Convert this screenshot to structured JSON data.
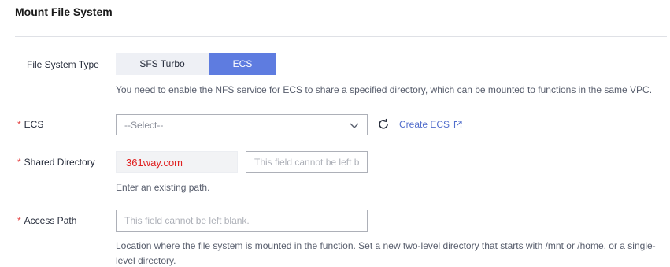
{
  "title": "Mount File System",
  "file_system_type": {
    "label": "File System Type",
    "options": [
      "SFS Turbo",
      "ECS"
    ],
    "selected": "ECS",
    "hint": "You need to enable the NFS service for ECS to share a specified directory, which can be mounted to functions in the same VPC."
  },
  "ecs": {
    "required_mark": "*",
    "label": "ECS",
    "placeholder": "--Select--",
    "create_link": "Create ECS"
  },
  "shared_directory": {
    "required_mark": "*",
    "label": "Shared Directory",
    "host_value": "361way.com",
    "path_placeholder": "This field cannot be left b",
    "hint": "Enter an existing path."
  },
  "access_path": {
    "required_mark": "*",
    "label": "Access Path",
    "placeholder": "This field cannot be left blank.",
    "hint_line1": "Location where the file system is mounted in the function. Set a new two-level directory that starts with /mnt or /home, or a single-",
    "hint_line2": "level directory."
  },
  "colors": {
    "accent": "#5e7ce0",
    "link": "#526ecc",
    "required": "#e54545",
    "host_text": "#e02020"
  }
}
